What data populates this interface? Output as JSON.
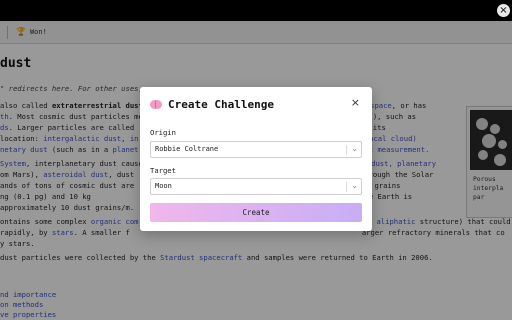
{
  "window": {
    "close_glyph": "×"
  },
  "status": {
    "badge_icon": "trophy-icon",
    "badge_text": "Won!"
  },
  "article": {
    "title": "dust",
    "hatnote": "\" redirects here. For other uses,",
    "lines": [
      [
        "also called ",
        "extraterrestrial dust",
        "",
        "ter space",
        ", or has"
      ],
      [
        "th",
        ". Most cosmic dust particles me",
        "",
        "",
        "), such as"
      ],
      [
        "ds",
        ". Larger particles are called ",
        "",
        "",
        " its"
      ],
      [
        "location: ",
        "intergalactic dust",
        ", ",
        "in",
        "diacal cloud)"
      ],
      [
        "netary dust",
        " (such as in a ",
        "planet",
        "",
        "st measurement."
      ]
    ],
    "para2": [
      [
        "System",
        ", interplanetary dust cause",
        "",
        "",
        " dust, planetary"
      ],
      [
        "om Mars), ",
        "asteroidal dust",
        ", dust ",
        "",
        "rough the Solar"
      ],
      [
        "ands of tons of cosmic dust are ",
        "",
        "",
        "",
        " most grains"
      ],
      [
        "ng (0.1 pg) and 10 kg",
        "",
        "",
        "",
        " the Earth is"
      ],
      [
        "approximately 10 dust grains/m.",
        "",
        "",
        "",
        ""
      ]
    ],
    "para3a_pre": "ontains some complex ",
    "para3a_link": "organic com",
    "para3a_link2": "aliphatic",
    "para3a_post": " structure) that could",
    "para3b_pre": "rapidly, by ",
    "para3b_link": "stars",
    "para3b_mid": ". A smaller f",
    "para3b_post": "arger refractory minerals that co",
    "para3c": "y stars.",
    "para4_pre": "dust particles were collected by the ",
    "para4_link": "Stardust spacecraft",
    "para4_post": " and samples were returned to Earth in 2006.",
    "toc": [
      "nd importance",
      "on methods",
      "ve properties"
    ],
    "figure_caption": [
      "Porous",
      "interpla",
      "par"
    ]
  },
  "modal": {
    "title": "Create Challenge",
    "title_icon": "brain-icon",
    "origin_label": "Origin",
    "origin_value": "Robbie Coltrane",
    "target_label": "Target",
    "target_value": "Moon",
    "create_label": "Create",
    "close_glyph": "×",
    "chevron_glyph": "⌄"
  }
}
